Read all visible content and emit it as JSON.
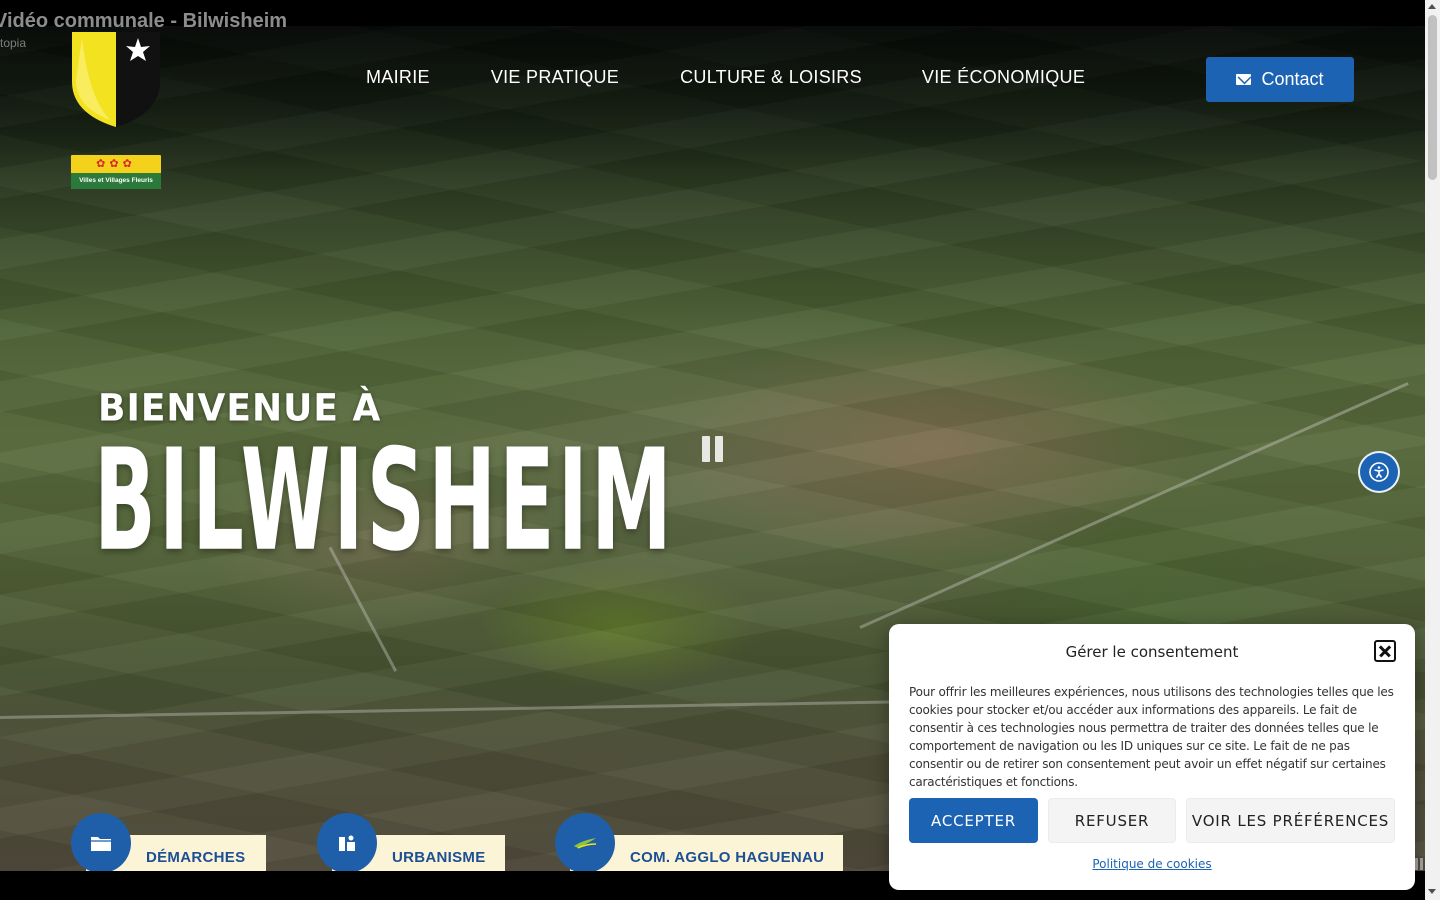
{
  "video": {
    "title": "Vidéo communale - Bilwisheim",
    "channel": "topia"
  },
  "label_badge": {
    "text": "Villes et Villages Fleuris"
  },
  "nav": {
    "items": [
      {
        "label": "MAIRIE"
      },
      {
        "label": "VIE PRATIQUE"
      },
      {
        "label": "CULTURE & LOISIRS"
      },
      {
        "label": "VIE ÉCONOMIQUE"
      }
    ],
    "contact_label": "Contact"
  },
  "hero": {
    "welcome": "BIENVENUE À",
    "town": "BILWISHEIM"
  },
  "quick_links": [
    {
      "label": "DÉMARCHES",
      "icon": "folder-icon"
    },
    {
      "label": "URBANISME",
      "icon": "urbanism-icon"
    },
    {
      "label": "COM. AGGLO HAGUENAU",
      "icon": "agglo-logo-icon"
    }
  ],
  "consent": {
    "title": "Gérer le consentement",
    "body": "Pour offrir les meilleures expériences, nous utilisons des technologies telles que les cookies pour stocker et/ou accéder aux informations des appareils. Le fait de consentir à ces technologies nous permettra de traiter des données telles que le comportement de navigation ou les ID uniques sur ce site. Le fait de ne pas consentir ou de retirer son consentement peut avoir un effet négatif sur certaines caractéristiques et fonctions.",
    "accept_label": "ACCEPTER",
    "refuse_label": "REFUSER",
    "preferences_label": "VOIR LES PRÉFÉRENCES",
    "policy_label": "Politique de cookies"
  },
  "colors": {
    "accent_blue": "#1d63b3",
    "quick_link_bg": "#fbf4d6",
    "shield_yellow": "#f3e21f"
  }
}
